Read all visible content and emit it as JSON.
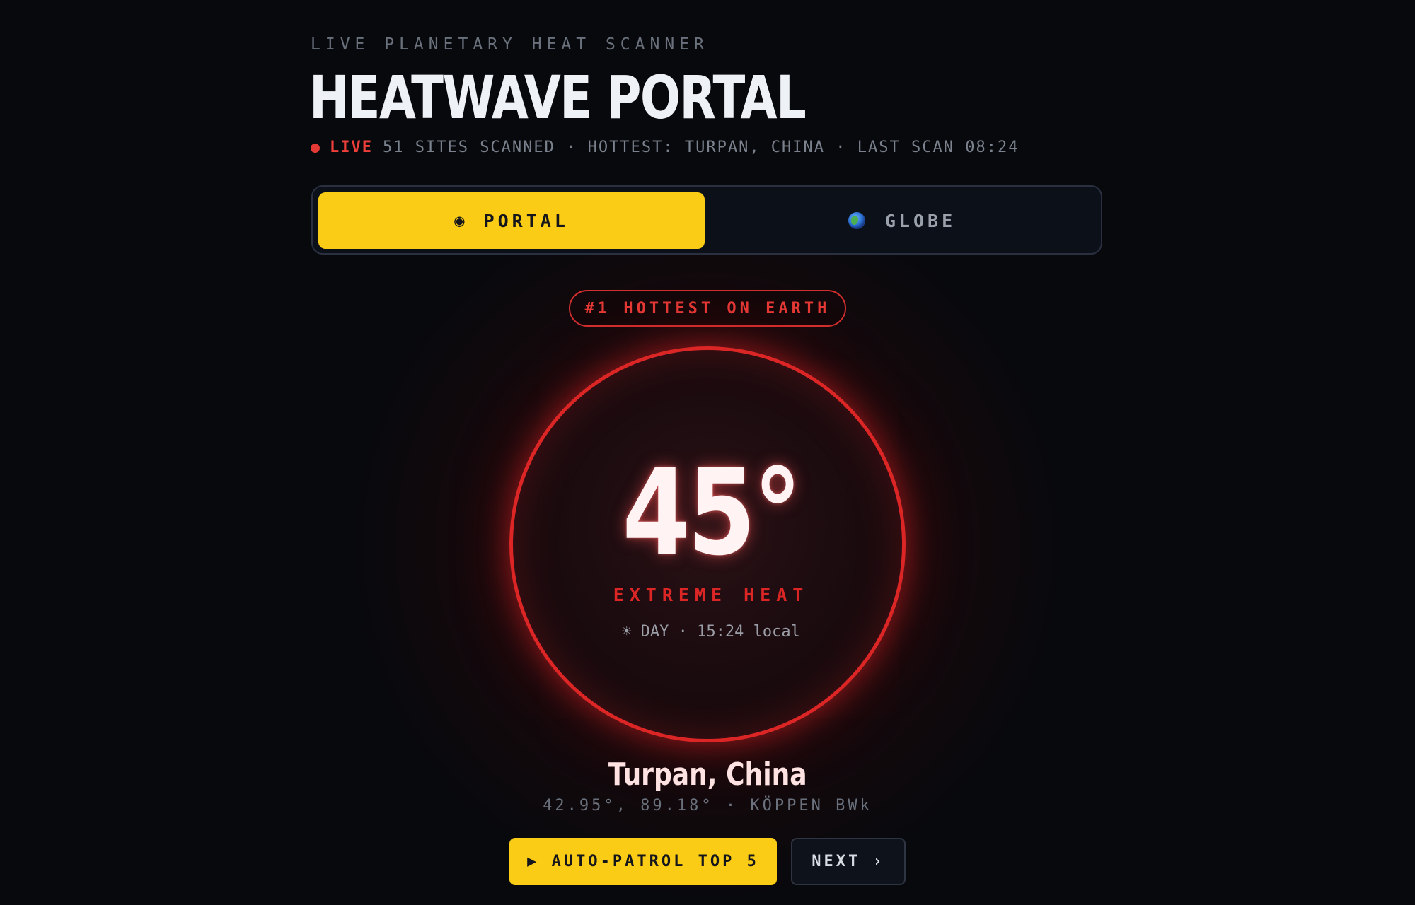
{
  "header": {
    "eyebrow": "LIVE PLANETARY HEAT SCANNER",
    "title": "HEATWAVE PORTAL",
    "live_label": "LIVE",
    "status": "51 SITES SCANNED · HOTTEST: TURPAN, CHINA · LAST SCAN 08:24"
  },
  "tabs": [
    {
      "icon": "◉",
      "label": "PORTAL",
      "active": true
    },
    {
      "icon": "globe-icon",
      "label": "GLOBE",
      "active": false
    }
  ],
  "badge": "#1 HOTTEST ON EARTH",
  "reading": {
    "temperature": "45°",
    "category": "EXTREME HEAT",
    "time_info": "☀ DAY · 15:24 local"
  },
  "location": {
    "name": "Turpan, China",
    "details": "42.95°, 89.18° · KÖPPEN BWk"
  },
  "actions": {
    "patrol_label": "▶ AUTO-PATROL TOP 5",
    "next_label": "NEXT ›"
  },
  "colors": {
    "accent": "#facc15",
    "heat": "#dc2626",
    "live": "#e53935",
    "background": "#07090d"
  }
}
